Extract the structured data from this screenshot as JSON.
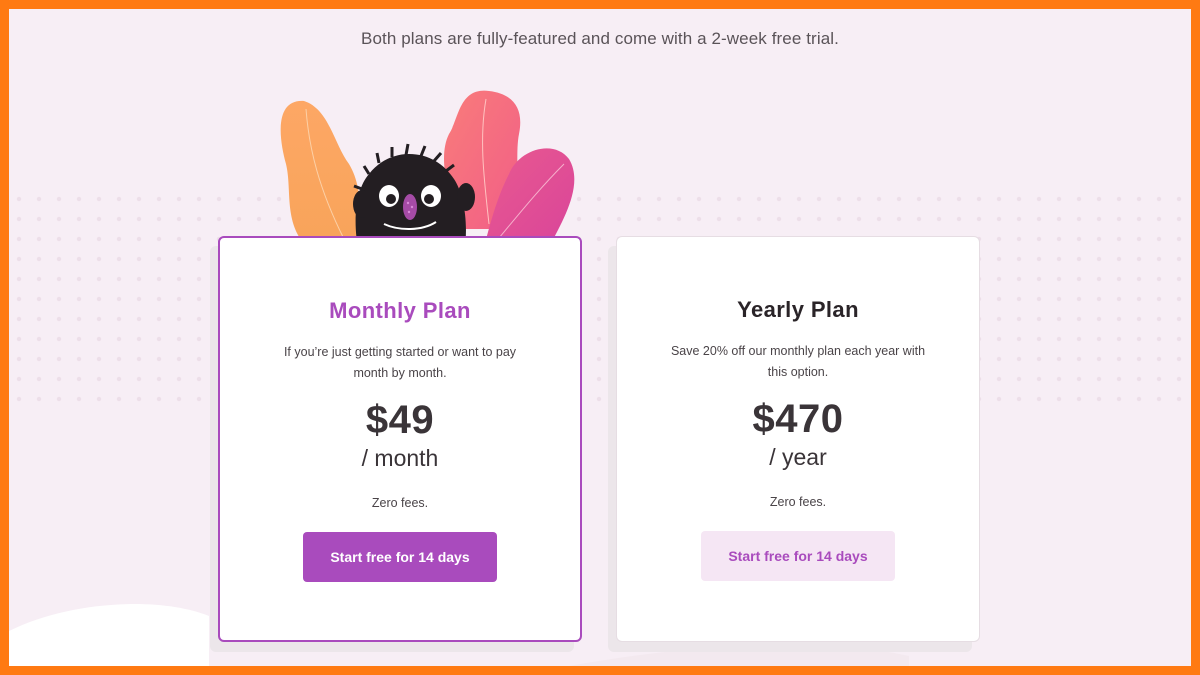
{
  "header": {
    "subtitle": "Both plans are fully-featured and come with a 2-week free trial."
  },
  "illustration": {
    "name": "monster-with-leaves",
    "colors": [
      "#fba45c",
      "#f7617e",
      "#e0478f",
      "#231e22",
      "#a54ba6"
    ]
  },
  "plans": [
    {
      "title": "Monthly Plan",
      "description": "If you’re just getting started or want to pay month by month.",
      "price": "$49",
      "period": "/ month",
      "fees": "Zero fees.",
      "cta": "Start free for 14 days",
      "highlighted": true
    },
    {
      "title": "Yearly Plan",
      "description": "Save 20% off our monthly plan each year with this option.",
      "price": "$470",
      "period": "/ year",
      "fees": "Zero fees.",
      "cta": "Start free for 14 days",
      "highlighted": false
    }
  ],
  "colors": {
    "accent": "#a94bbd",
    "accent_light": "#f5e6f4",
    "border": "#ff7a12",
    "background": "#f7eef5"
  }
}
